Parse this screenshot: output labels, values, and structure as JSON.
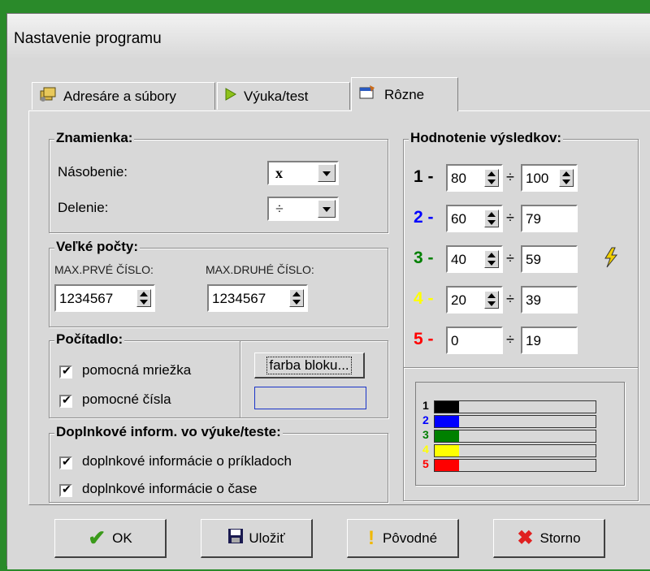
{
  "window": {
    "title": "Nastavenie programu"
  },
  "tabs": [
    {
      "label": "Adresáre a súbory",
      "icon": "folders-icon"
    },
    {
      "label": "Výuka/test",
      "icon": "play-arrow-icon"
    },
    {
      "label": "Rôzne",
      "icon": "settings-window-icon"
    }
  ],
  "znamienka": {
    "legend": "Znamienka:",
    "nasobenie_label": "Násobenie:",
    "nasobenie_value": "x",
    "delenie_label": "Delenie:",
    "delenie_value": "÷"
  },
  "velke": {
    "legend": "Veľké počty:",
    "max1_label": "MAX.PRVÉ ČÍSLO:",
    "max1_value": "1234567",
    "max2_label": "MAX.DRUHÉ ČÍSLO:",
    "max2_value": "1234567"
  },
  "pocitadlo": {
    "legend": "Počítadlo:",
    "cb1": "pomocná mriežka",
    "cb2": "pomocné čísla",
    "button": "farba bloku..."
  },
  "doplnkove": {
    "legend": "Doplnkové inform. vo výuke/teste:",
    "cb1": "doplnkové informácie o príkladoch",
    "cb2": "doplnkové informácie o čase"
  },
  "hodnotenie": {
    "legend": "Hodnotenie výsledkov:",
    "div_symbol": "÷",
    "rows": [
      {
        "grade": "1 -",
        "color": "#000000",
        "from": "80",
        "to": "100"
      },
      {
        "grade": "2 -",
        "color": "#0000ff",
        "from": "60",
        "to": "79"
      },
      {
        "grade": "3 -",
        "color": "#008000",
        "from": "40",
        "to": "59"
      },
      {
        "grade": "4 -",
        "color": "#ffff00",
        "from": "20",
        "to": "39"
      },
      {
        "grade": "5 -",
        "color": "#ff0000",
        "from": "0",
        "to": "19"
      }
    ],
    "bars": [
      {
        "label": "1",
        "color": "#000000"
      },
      {
        "label": "2",
        "color": "#0000ff"
      },
      {
        "label": "3",
        "color": "#008000"
      },
      {
        "label": "4",
        "color": "#ffff00"
      },
      {
        "label": "5",
        "color": "#ff0000"
      }
    ]
  },
  "buttons": {
    "ok": "OK",
    "save": "Uložiť",
    "default": "Pôvodné",
    "cancel": "Storno"
  }
}
